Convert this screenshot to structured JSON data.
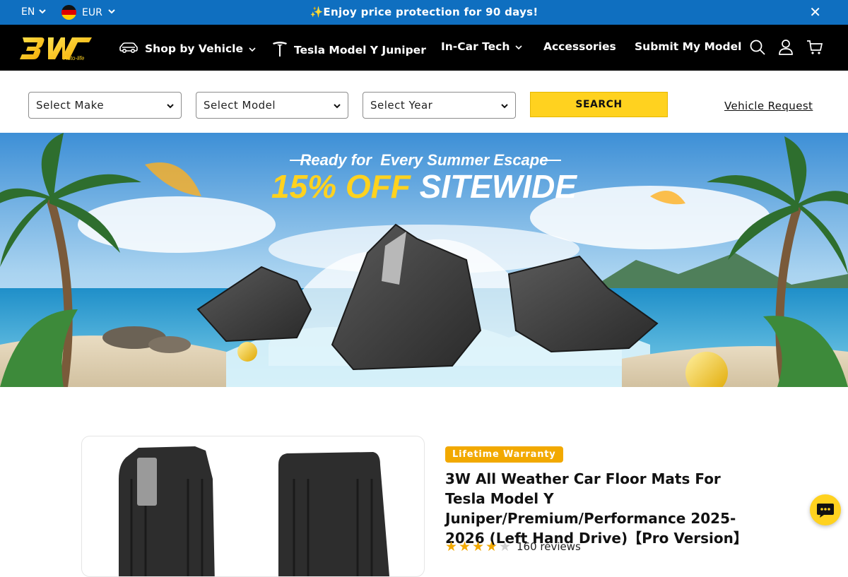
{
  "announcement": {
    "language": "EN",
    "currency": "EUR",
    "message": "✨Enjoy price protection for 90 days!",
    "close_symbol": "✕"
  },
  "header": {
    "logo_text": "3W",
    "logo_sub": "Auto-life",
    "nav": [
      {
        "label": "Shop by Vehicle"
      },
      {
        "label": "Tesla Model Y Juniper"
      },
      {
        "label": "In-Car Tech"
      },
      {
        "label": "Accessories"
      },
      {
        "label": "Submit My Model"
      }
    ]
  },
  "selector": {
    "make": "Select Make",
    "model": "Select Model",
    "year": "Select Year",
    "search_label": "SEARCH",
    "vehicle_request": "Vehicle Request"
  },
  "hero": {
    "tagline": "Ready for  Every Summer Escape",
    "offer_highlight": "15% OFF",
    "offer_rest": "SITEWIDE"
  },
  "product": {
    "badge": "Lifetime Warranty",
    "title": "3W All Weather Car Floor Mats For Tesla Model Y Juniper/Premium/Performance 2025-2026 (Left Hand Drive)【Pro Version】",
    "rating": 4,
    "rating_max": 5,
    "reviews": "160 reviews"
  },
  "colors": {
    "announce_bg": "#0f6fc0",
    "header_bg": "#000000",
    "accent_yellow": "#ffd21f",
    "badge_orange": "#f2a900"
  }
}
